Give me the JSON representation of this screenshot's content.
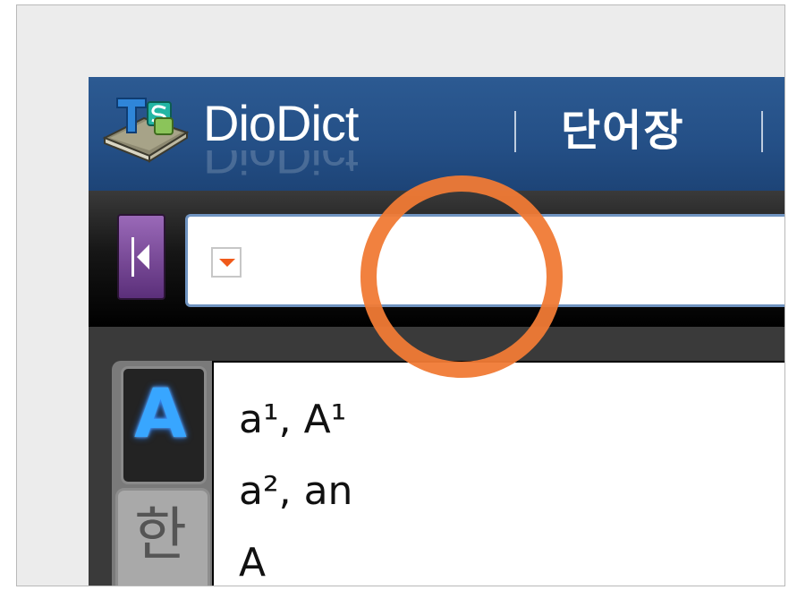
{
  "header": {
    "app_name": "DioDict",
    "tab_label": "단어장"
  },
  "search": {
    "placeholder": "",
    "value": ""
  },
  "side_tabs": {
    "english": "A",
    "korean": "한"
  },
  "word_list": [
    "a¹, A¹",
    "a², an",
    "A"
  ],
  "colors": {
    "header_blue": "#2a5790",
    "highlight": "#f07a35",
    "accent_purple": "#6d3a8e",
    "dropdown_arrow": "#f05a1a",
    "side_tab_glow": "#38a6ff"
  },
  "icons": {
    "logo": "dictionary-book-icon",
    "collapse": "collapse-left-icon",
    "dropdown": "dropdown-arrow-icon"
  }
}
